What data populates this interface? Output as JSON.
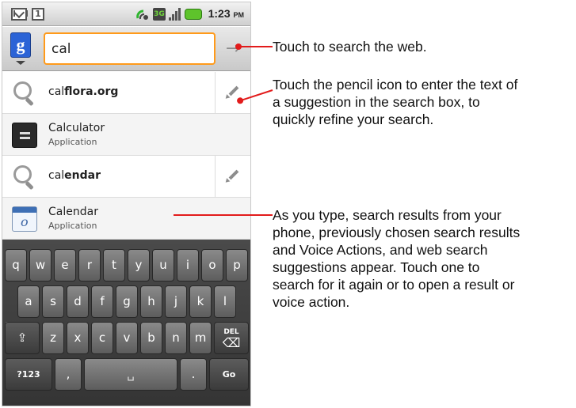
{
  "status_bar": {
    "time": "1:23",
    "ampm": "PM",
    "calendar_badge": "1",
    "network": "3G",
    "icons": [
      "gmail-icon",
      "calendar-notification-icon",
      "sync-icon",
      "3g-data-icon",
      "signal-strength-icon",
      "battery-icon"
    ]
  },
  "search": {
    "value": "cal",
    "engine_icon": "g",
    "go_icon": "→"
  },
  "suggestions": [
    {
      "type": "web",
      "prefix": "cal",
      "rest": "flora.org",
      "has_pencil": true
    },
    {
      "type": "app",
      "title": "Calculator",
      "subtitle": "Application"
    },
    {
      "type": "web",
      "prefix": "cal",
      "rest": "endar",
      "has_pencil": true
    },
    {
      "type": "app",
      "title": "Calendar",
      "subtitle": "Application"
    }
  ],
  "keyboard": {
    "row1": [
      "q",
      "w",
      "e",
      "r",
      "t",
      "y",
      "u",
      "i",
      "o",
      "p"
    ],
    "row2": [
      "a",
      "s",
      "d",
      "f",
      "g",
      "h",
      "j",
      "k",
      "l"
    ],
    "row3": [
      "z",
      "x",
      "c",
      "v",
      "b",
      "n",
      "m"
    ],
    "shift_icon": "⇪",
    "delete_label": "DEL",
    "delete_icon": "⌫",
    "mode_label": "?123",
    "comma": ",",
    "space_icon": "␣",
    "period": ".",
    "go_label": "Go"
  },
  "callouts": [
    {
      "lines": [
        "Touch to search the web."
      ]
    },
    {
      "lines": [
        "Touch the pencil icon to enter the text of",
        "a suggestion in the search box, to",
        "quickly refine your search."
      ]
    },
    {
      "lines": [
        "As you type, search results from your",
        "phone, previously chosen search results",
        "and Voice Actions, and web search",
        "suggestions appear. Touch one to",
        "search for it again or to open a result or",
        "voice action."
      ]
    }
  ],
  "colors": {
    "callout_line": "#e21b1b",
    "search_focus": "#ff9a1a",
    "google_button": "#2b63d6",
    "battery": "#5ec32b"
  }
}
